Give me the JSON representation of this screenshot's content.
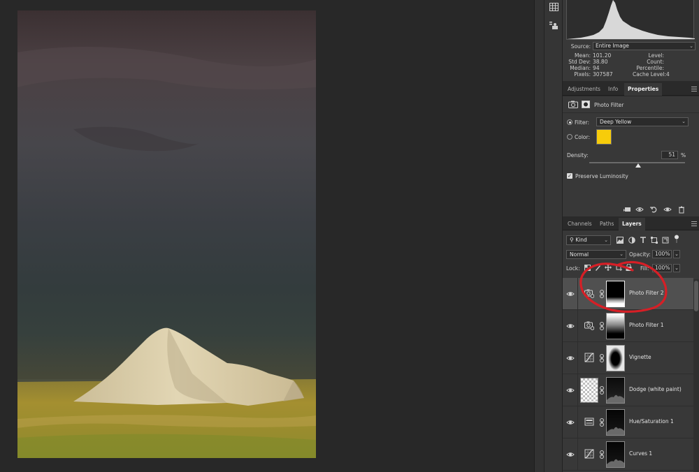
{
  "histogram": {
    "source_label": "Source:",
    "source_value": "Entire Image",
    "stats_left": [
      {
        "label": "Mean:",
        "value": "101.20"
      },
      {
        "label": "Std Dev:",
        "value": "38.80"
      },
      {
        "label": "Median:",
        "value": "94"
      },
      {
        "label": "Pixels:",
        "value": "307587"
      }
    ],
    "stats_right": [
      {
        "label": "Level:",
        "value": ""
      },
      {
        "label": "Count:",
        "value": ""
      },
      {
        "label": "Percentile:",
        "value": ""
      },
      {
        "label": "Cache Level:",
        "value": "4"
      }
    ]
  },
  "props_tabs": [
    "Adjustments",
    "Info",
    "Properties"
  ],
  "properties": {
    "title": "Photo Filter",
    "filter_label": "Filter:",
    "filter_value": "Deep Yellow",
    "color_label": "Color:",
    "color_swatch": "#f7cc0a",
    "density_label": "Density:",
    "density_value": "51",
    "density_unit": "%",
    "density_fraction": 0.51,
    "preserve_label": "Preserve Luminosity"
  },
  "layers_tabs": [
    "Channels",
    "Paths",
    "Layers"
  ],
  "layers_panel": {
    "kind_label": "Kind",
    "blend_mode": "Normal",
    "opacity_label": "Opacity:",
    "opacity_value": "100%",
    "lock_label": "Lock:",
    "fill_label": "Fill:",
    "fill_value": "100%"
  },
  "layers": [
    {
      "name": "Photo Filter 2",
      "type": "photo-filter",
      "selected": true
    },
    {
      "name": "Photo Filter 1",
      "type": "photo-filter",
      "selected": false
    },
    {
      "name": "Vignette",
      "type": "curves",
      "selected": false
    },
    {
      "name": "Dodge (white paint)",
      "type": "pixel",
      "selected": false
    },
    {
      "name": "Hue/Saturation 1",
      "type": "hue-saturation",
      "selected": false
    },
    {
      "name": "Curves 1",
      "type": "curves",
      "selected": false
    }
  ],
  "colors": {
    "annotation": "#d61f26",
    "panel_bg": "#383838",
    "selected_layer": "#505050"
  }
}
